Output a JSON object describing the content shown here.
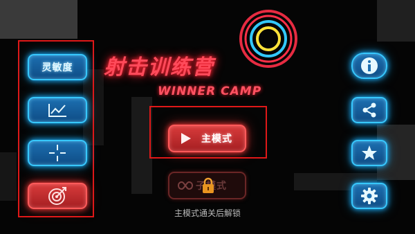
{
  "title": "射击训练营",
  "subtitle": "WINNER CAMP",
  "left_menu": {
    "sensitivity_label": "灵敏度"
  },
  "main": {
    "main_mode_label": "主模式",
    "locked_mode_label": "子模式",
    "unlock_hint": "主模式通关后解锁"
  },
  "colors": {
    "blue": "#37c8ff",
    "red": "#ff4a4a",
    "frame": "#e01818"
  },
  "icons": [
    "chart-icon",
    "crosshair-icon",
    "target-icon",
    "info-icon",
    "share-icon",
    "star-icon",
    "gear-icon",
    "lock-icon",
    "infinity-icon",
    "play-icon"
  ]
}
